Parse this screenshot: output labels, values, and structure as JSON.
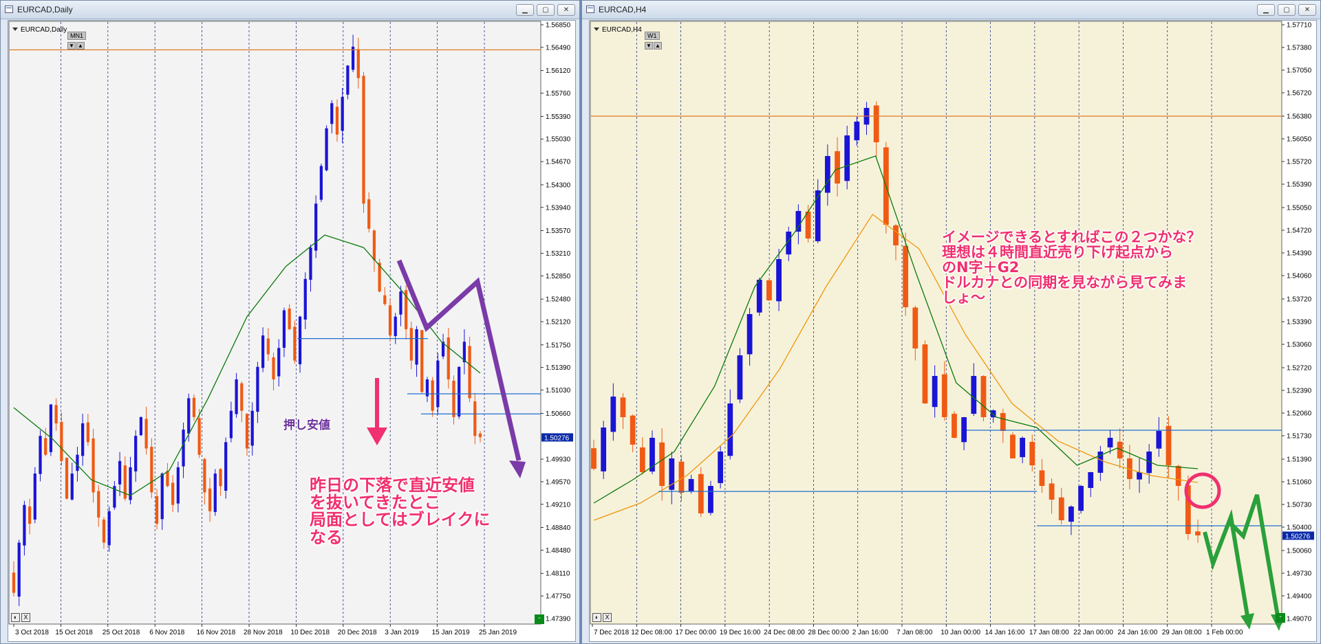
{
  "left": {
    "title": "EURCAD,Daily",
    "symbol_label": "EURCAD,Daily",
    "timeframe": "MN1",
    "price_ticks": [
      "1.56850",
      "1.56490",
      "1.56120",
      "1.55760",
      "1.55390",
      "1.55030",
      "1.54670",
      "1.54300",
      "1.53940",
      "1.53570",
      "1.53210",
      "1.52850",
      "1.52480",
      "1.52120",
      "1.51750",
      "1.51390",
      "1.51030",
      "1.50660",
      "1.50276",
      "1.49930",
      "1.49570",
      "1.49210",
      "1.48840",
      "1.48480",
      "1.48110",
      "1.47750",
      "1.47390"
    ],
    "current_price": "1.50276",
    "date_ticks": [
      "3 Oct 2018",
      "15 Oct 2018",
      "25 Oct 2018",
      "6 Nov 2018",
      "16 Nov 2018",
      "28 Nov 2018",
      "10 Dec 2018",
      "20 Dec 2018",
      "3 Jan 2019",
      "15 Jan 2019",
      "25 Jan 2019"
    ],
    "annotation_main": "昨日の下落で直近安値\nを抜いてきたとこ\n局面としてはブレイクに\nなる",
    "annotation_support": "押し安値",
    "ctrl": [
      "◐",
      "X"
    ],
    "green_btn": "-"
  },
  "right": {
    "title": "EURCAD,H4",
    "symbol_label": "EURCAD,H4",
    "timeframe": "W1",
    "price_ticks": [
      "1.57710",
      "1.57380",
      "1.57050",
      "1.56720",
      "1.56380",
      "1.56050",
      "1.55720",
      "1.55390",
      "1.55050",
      "1.54720",
      "1.54390",
      "1.54060",
      "1.53720",
      "1.53390",
      "1.53060",
      "1.52720",
      "1.52390",
      "1.52060",
      "1.51730",
      "1.51390",
      "1.51060",
      "1.50730",
      "1.50400",
      "1.50276",
      "1.50060",
      "1.49730",
      "1.49400",
      "1.49070"
    ],
    "current_price": "1.50276",
    "date_ticks": [
      "7 Dec 2018",
      "12 Dec 08:00",
      "17 Dec 00:00",
      "19 Dec 16:00",
      "24 Dec 08:00",
      "28 Dec 00:00",
      "2 Jan 16:00",
      "7 Jan 08:00",
      "10 Jan 00:00",
      "14 Jan 16:00",
      "17 Jan 08:00",
      "22 Jan 00:00",
      "24 Jan 16:00",
      "29 Jan 08:00",
      "1 Feb 00:00"
    ],
    "annotation_main": "イメージできるとすればこの２つかな？\n理想は４時間直近売り下げ起点から\nのN字＋G2\nドルカナとの同期を見ながら見てみま\nしょ～",
    "ctrl": [
      "◐",
      "X"
    ],
    "green_btn": "-"
  },
  "window_buttons": [
    "▁",
    "▢",
    "✕"
  ],
  "colors": {
    "bull": "#1a14d6",
    "bear": "#f05a14",
    "ma_green": "#0b7a0b",
    "ma_orange": "#f0960a",
    "hline_orange": "#e07820",
    "hline_blue": "#1e6ed0",
    "purple": "#7a3aa8",
    "pink": "#f03070",
    "arrow_green": "#2aa03a",
    "chart_bg_right": "#f6f2da",
    "chart_bg_left": "#f3f3f3"
  },
  "chart_data": [
    {
      "type": "candlestick",
      "title": "EURCAD,Daily",
      "ylim": [
        1.4739,
        1.5685
      ],
      "y_ticks": [
        "1.56850",
        "1.56490",
        "1.56120",
        "1.55760",
        "1.55390",
        "1.55030",
        "1.54670",
        "1.54300",
        "1.53940",
        "1.53570",
        "1.53210",
        "1.52850",
        "1.52480",
        "1.52120",
        "1.51750",
        "1.51390",
        "1.51030",
        "1.50660",
        "1.49930",
        "1.49570",
        "1.49210",
        "1.48840",
        "1.48480",
        "1.48110",
        "1.47750",
        "1.47390"
      ],
      "x_ticks": [
        "3 Oct 2018",
        "15 Oct 2018",
        "25 Oct 2018",
        "6 Nov 2018",
        "16 Nov 2018",
        "28 Nov 2018",
        "10 Dec 2018",
        "20 Dec 2018",
        "3 Jan 2019",
        "15 Jan 2019",
        "25 Jan 2019"
      ],
      "close_series": [
        1.478,
        1.486,
        1.492,
        1.489,
        1.497,
        1.503,
        1.5,
        1.508,
        1.505,
        1.499,
        1.493,
        1.497,
        1.5,
        1.505,
        1.502,
        1.494,
        1.49,
        1.486,
        1.491,
        1.495,
        1.499,
        1.493,
        1.498,
        1.503,
        1.506,
        1.501,
        1.494,
        1.489,
        1.497,
        1.495,
        1.492,
        1.498,
        1.504,
        1.509,
        1.506,
        1.5,
        1.494,
        1.491,
        1.497,
        1.495,
        1.502,
        1.507,
        1.512,
        1.507,
        1.501,
        1.507,
        1.514,
        1.519,
        1.516,
        1.512,
        1.517,
        1.523,
        1.52,
        1.515,
        1.522,
        1.528,
        1.533,
        1.54,
        1.546,
        1.552,
        1.556,
        1.551,
        1.557,
        1.562,
        1.565,
        1.56,
        1.54,
        1.536,
        1.531,
        1.526,
        1.524,
        1.519,
        1.522,
        1.526,
        1.52,
        1.515,
        1.52,
        1.51,
        1.512,
        1.507,
        1.515,
        1.518,
        1.512,
        1.506,
        1.514,
        1.518,
        1.509,
        1.503,
        1.5028
      ],
      "ma": [
        1.5075,
        1.5025,
        1.496,
        1.4935,
        1.4975,
        1.509,
        1.522,
        1.53,
        1.535,
        1.533,
        1.526,
        1.518,
        1.513
      ],
      "hlines": [
        1.5645,
        1.5185,
        1.5097,
        1.5065
      ],
      "current": 1.50276
    },
    {
      "type": "candlestick",
      "title": "EURCAD,H4",
      "ylim": [
        1.4907,
        1.5771
      ],
      "y_ticks": [
        "1.57710",
        "1.57380",
        "1.57050",
        "1.56720",
        "1.56380",
        "1.56050",
        "1.55720",
        "1.55390",
        "1.55050",
        "1.54720",
        "1.54390",
        "1.54060",
        "1.53720",
        "1.53390",
        "1.53060",
        "1.52720",
        "1.52390",
        "1.52060",
        "1.51730",
        "1.51390",
        "1.51060",
        "1.50730",
        "1.50400",
        "1.50060",
        "1.49730",
        "1.49400",
        "1.49070"
      ],
      "x_ticks": [
        "7 Dec 2018",
        "12 Dec 08:00",
        "17 Dec 00:00",
        "19 Dec 16:00",
        "24 Dec 08:00",
        "28 Dec 00:00",
        "2 Jan 16:00",
        "7 Jan 08:00",
        "10 Jan 00:00",
        "14 Jan 16:00",
        "17 Jan 08:00",
        "22 Jan 00:00",
        "24 Jan 16:00",
        "29 Jan 08:00",
        "1 Feb 00:00"
      ],
      "close_series": [
        1.5125,
        1.5185,
        1.523,
        1.52,
        1.516,
        1.512,
        1.517,
        1.51,
        1.514,
        1.509,
        1.511,
        1.506,
        1.51,
        1.515,
        1.522,
        1.529,
        1.535,
        1.54,
        1.537,
        1.543,
        1.547,
        1.55,
        1.546,
        1.553,
        1.558,
        1.554,
        1.561,
        1.563,
        1.565,
        1.56,
        1.548,
        1.545,
        1.536,
        1.53,
        1.522,
        1.526,
        1.52,
        1.517,
        1.52,
        1.526,
        1.52,
        1.521,
        1.518,
        1.514,
        1.517,
        1.513,
        1.51,
        1.508,
        1.505,
        1.507,
        1.51,
        1.512,
        1.515,
        1.517,
        1.514,
        1.511,
        1.512,
        1.515,
        1.518,
        1.513,
        1.51,
        1.503,
        1.5028
      ],
      "ma_fast": [
        1.5075,
        1.511,
        1.515,
        1.5245,
        1.539,
        1.547,
        1.556,
        1.558,
        1.541,
        1.525,
        1.52,
        1.5185,
        1.513,
        1.5155,
        1.513,
        1.5125
      ],
      "ma_slow": [
        1.505,
        1.5075,
        1.5115,
        1.5175,
        1.527,
        1.539,
        1.5495,
        1.5445,
        1.532,
        1.522,
        1.5165,
        1.5135,
        1.5115,
        1.5105
      ],
      "hlines": [
        1.5638,
        1.5181,
        1.5092,
        1.5042
      ],
      "current": 1.50276
    }
  ]
}
